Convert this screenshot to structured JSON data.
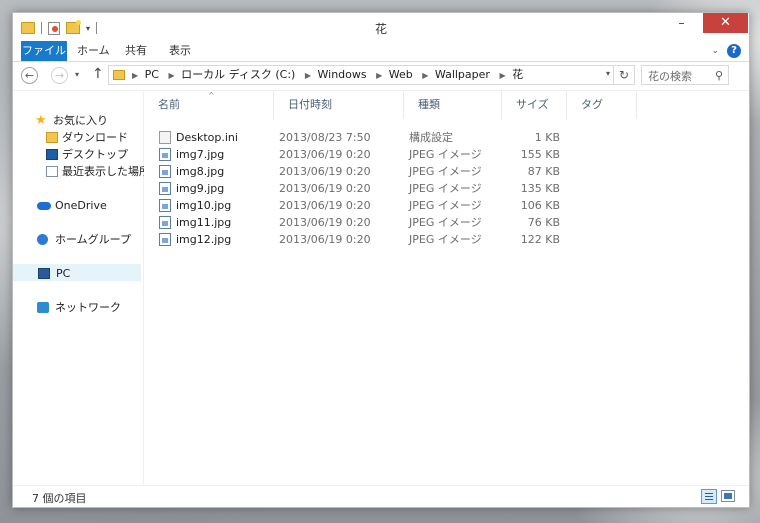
{
  "window": {
    "title": "花",
    "controls": {
      "minimize": "–",
      "maximize": "☐",
      "close": "✕"
    }
  },
  "ribbon": {
    "tabs": [
      "ファイル",
      "ホーム",
      "共有",
      "表示"
    ],
    "help": "?"
  },
  "address": {
    "crumbs": [
      "PC",
      "ローカル ディスク (C:)",
      "Windows",
      "Web",
      "Wallpaper",
      "花"
    ]
  },
  "search": {
    "placeholder": "花の検索"
  },
  "nav": {
    "favorites": "お気に入り",
    "downloads": "ダウンロード",
    "desktop": "デスクトップ",
    "recent": "最近表示した場所",
    "onedrive": "OneDrive",
    "homegroup": "ホームグループ",
    "pc": "PC",
    "network": "ネットワーク"
  },
  "columns": {
    "name": "名前",
    "date": "日付時刻",
    "type": "種類",
    "size": "サイズ",
    "tag": "タグ"
  },
  "files": [
    {
      "name": "Desktop.ini",
      "date": "2013/08/23 7:50",
      "type": "構成設定",
      "size": "1 KB",
      "icon": "settings-file-icon"
    },
    {
      "name": "img7.jpg",
      "date": "2013/06/19 0:20",
      "type": "JPEG イメージ",
      "size": "155 KB",
      "icon": "image-file-icon"
    },
    {
      "name": "img8.jpg",
      "date": "2013/06/19 0:20",
      "type": "JPEG イメージ",
      "size": "87 KB",
      "icon": "image-file-icon"
    },
    {
      "name": "img9.jpg",
      "date": "2013/06/19 0:20",
      "type": "JPEG イメージ",
      "size": "135 KB",
      "icon": "image-file-icon"
    },
    {
      "name": "img10.jpg",
      "date": "2013/06/19 0:20",
      "type": "JPEG イメージ",
      "size": "106 KB",
      "icon": "image-file-icon"
    },
    {
      "name": "img11.jpg",
      "date": "2013/06/19 0:20",
      "type": "JPEG イメージ",
      "size": "76 KB",
      "icon": "image-file-icon"
    },
    {
      "name": "img12.jpg",
      "date": "2013/06/19 0:20",
      "type": "JPEG イメージ",
      "size": "122 KB",
      "icon": "image-file-icon"
    }
  ],
  "status": {
    "count": "7 個の項目"
  },
  "colors": {
    "accent": "#1979ca",
    "close": "#c7423c",
    "selection": "#e5f3fb"
  }
}
